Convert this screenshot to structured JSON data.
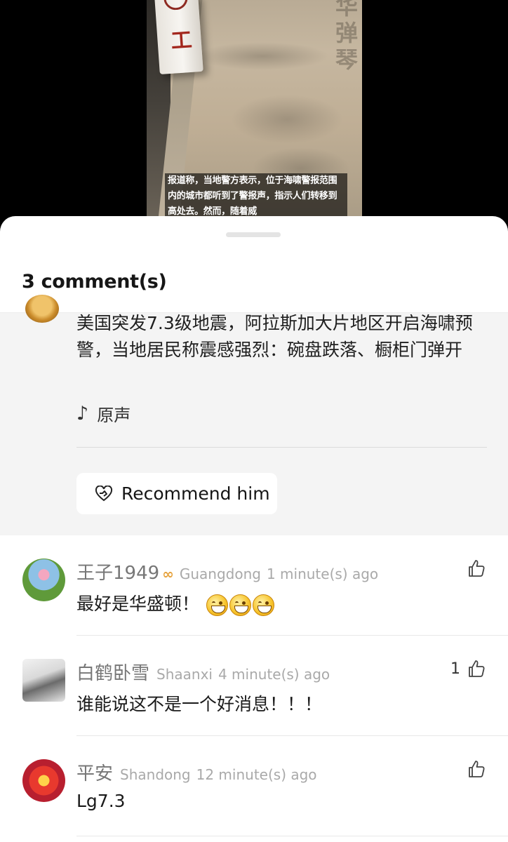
{
  "video": {
    "watermark": "华 弹 琴",
    "post_marking": "工",
    "subtitle": "报道称，当地警方表示，位于海啸警报范围内的城市都听到了警报声，指示人们转移到高处去。然而，随着威"
  },
  "sheet": {
    "title": "3 comment(s)"
  },
  "post": {
    "text": "美国突发7.3级地震，阿拉斯加大片地区开启海啸预警，当地居民称震感强烈：碗盘跌落、橱柜门弹开",
    "sound_label": "原声",
    "recommend_label": "Recommend him"
  },
  "comments": [
    {
      "name": "王子1949",
      "location": "Guangdong",
      "time": "1 minute(s) ago",
      "text": "最好是华盛顿！",
      "emoji_count": 3,
      "likes": "",
      "has_badge": true
    },
    {
      "name": "白鹤卧雪",
      "location": "Shaanxi",
      "time": "4 minute(s) ago",
      "text": "谁能说这不是一个好消息！！！",
      "likes": "1"
    },
    {
      "name": "平安",
      "location": "Shandong",
      "time": "12 minute(s) ago",
      "text": "Lg7.3",
      "likes": ""
    }
  ]
}
